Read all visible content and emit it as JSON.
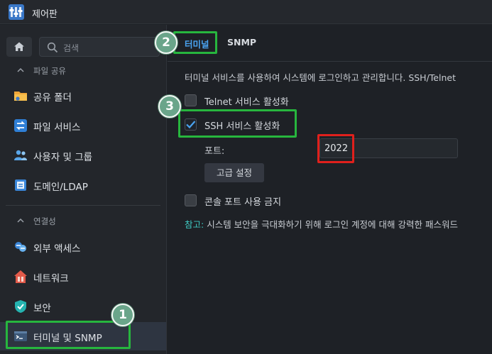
{
  "window": {
    "title": "제어판"
  },
  "sidebar": {
    "search_placeholder": "검색",
    "sections": [
      {
        "label": "파일 공유"
      },
      {
        "label": "연결성"
      }
    ],
    "items": [
      {
        "label": "공유 폴더",
        "icon": "shared-folder-icon"
      },
      {
        "label": "파일 서비스",
        "icon": "file-services-icon"
      },
      {
        "label": "사용자 및 그룹",
        "icon": "users-groups-icon"
      },
      {
        "label": "도메인/LDAP",
        "icon": "domain-ldap-icon"
      },
      {
        "label": "외부 액세스",
        "icon": "external-access-icon"
      },
      {
        "label": "네트워크",
        "icon": "network-icon"
      },
      {
        "label": "보안",
        "icon": "security-shield-icon"
      },
      {
        "label": "터미널 및 SNMP",
        "icon": "terminal-icon",
        "active": true
      }
    ]
  },
  "tabs": [
    {
      "label": "터미널",
      "active": true
    },
    {
      "label": "SNMP",
      "active": false
    }
  ],
  "main": {
    "description": "터미널 서비스를 사용하여 시스템에 로그인하고 관리합니다. SSH/Telnet",
    "telnet_label": "Telnet 서비스 활성화",
    "telnet_checked": false,
    "ssh_label": "SSH 서비스 활성화",
    "ssh_checked": true,
    "port_label": "포트:",
    "port_value": "2022",
    "advanced_button": "고급 설정",
    "console_label": "콘솔 포트 사용 금지",
    "console_checked": false,
    "note_key": "참고:",
    "note_text": " 시스템 보안을 극대화하기 위해 로그인 계정에 대해 강력한 패스워드"
  },
  "annotations": {
    "badge1": "1",
    "badge2": "2",
    "badge3": "3"
  },
  "colors": {
    "accent": "#4aa3f0",
    "highlight_green": "#27b63e",
    "highlight_red": "#e0201c",
    "note_key": "#3ec9c1"
  }
}
